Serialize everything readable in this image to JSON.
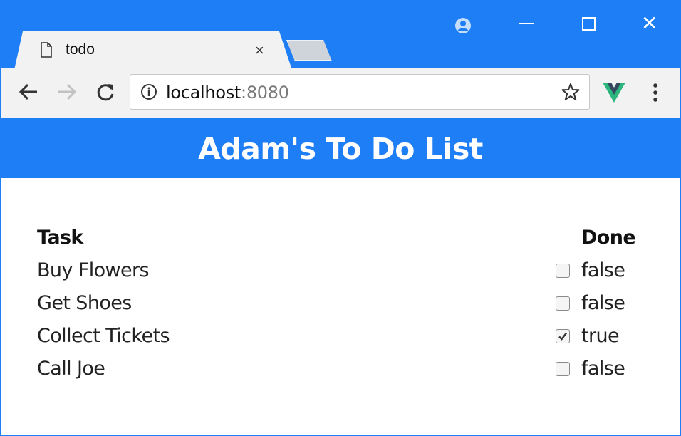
{
  "browser": {
    "tab_title": "todo",
    "tab_close_glyph": "×",
    "window_close_glyph": "✕",
    "url_host": "localhost",
    "url_port": ":8080"
  },
  "page": {
    "title": "Adam's To Do List"
  },
  "table": {
    "headers": {
      "task": "Task",
      "done": "Done"
    },
    "rows": [
      {
        "task": "Buy Flowers",
        "done": "false"
      },
      {
        "task": "Get Shoes",
        "done": "false"
      },
      {
        "task": "Collect Tickets",
        "done": "true"
      },
      {
        "task": "Call Joe",
        "done": "false"
      }
    ]
  },
  "colors": {
    "accent": "#1e7ef5",
    "toolbar": "#f2f2f2",
    "vue_green": "#2cb67d"
  },
  "icons": [
    "page-icon",
    "back-icon",
    "forward-icon",
    "reload-icon",
    "info-icon",
    "star-icon",
    "vue-extension-icon",
    "menu-icon",
    "profile-icon",
    "minimize-icon",
    "maximize-icon",
    "close-icon",
    "checkbox-icon"
  ]
}
